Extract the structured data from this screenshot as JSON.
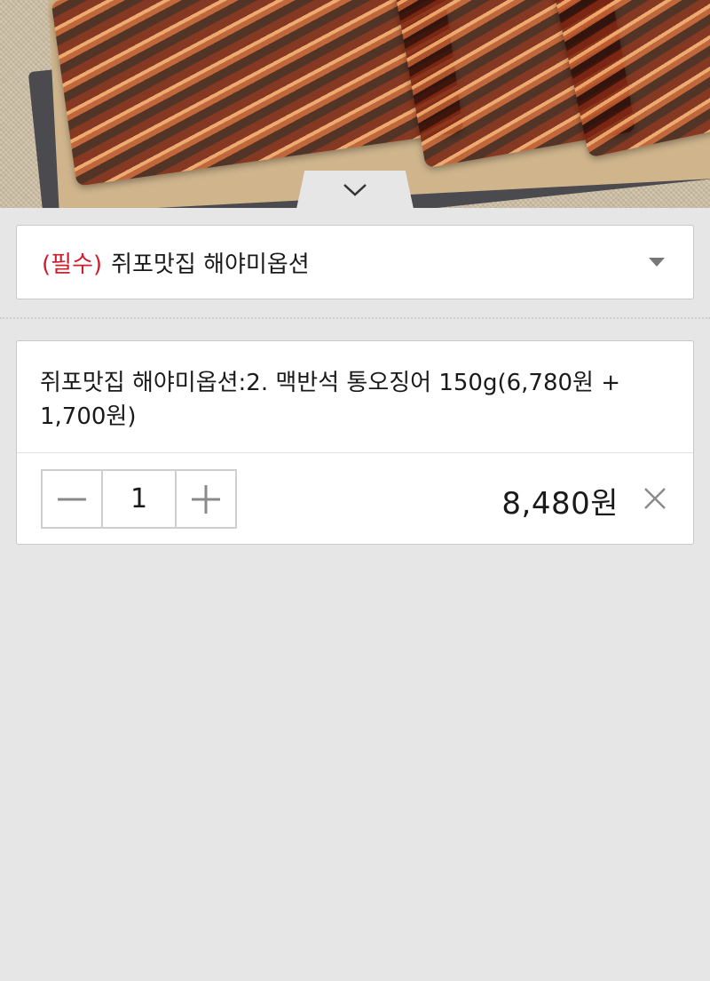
{
  "product_photo": {
    "alt": "product-photo-dried-squid",
    "collapse_icon": "chevron-down-icon"
  },
  "option_select": {
    "required_label": "(필수)",
    "label": "쥐포맛집 해야미옵션",
    "arrow_icon": "caret-down-icon"
  },
  "selected_item": {
    "name": "쥐포맛집 해야미옵션:2. 맥반석 통오징어 150g(6,780원 + 1,700원)",
    "quantity": "1",
    "decrease_icon": "minus-icon",
    "increase_icon": "plus-icon",
    "price": "8,480원",
    "remove_icon": "close-icon"
  },
  "colors": {
    "background": "#e6e6e6",
    "required": "#cc1f2e",
    "border": "#c9c9c9"
  }
}
